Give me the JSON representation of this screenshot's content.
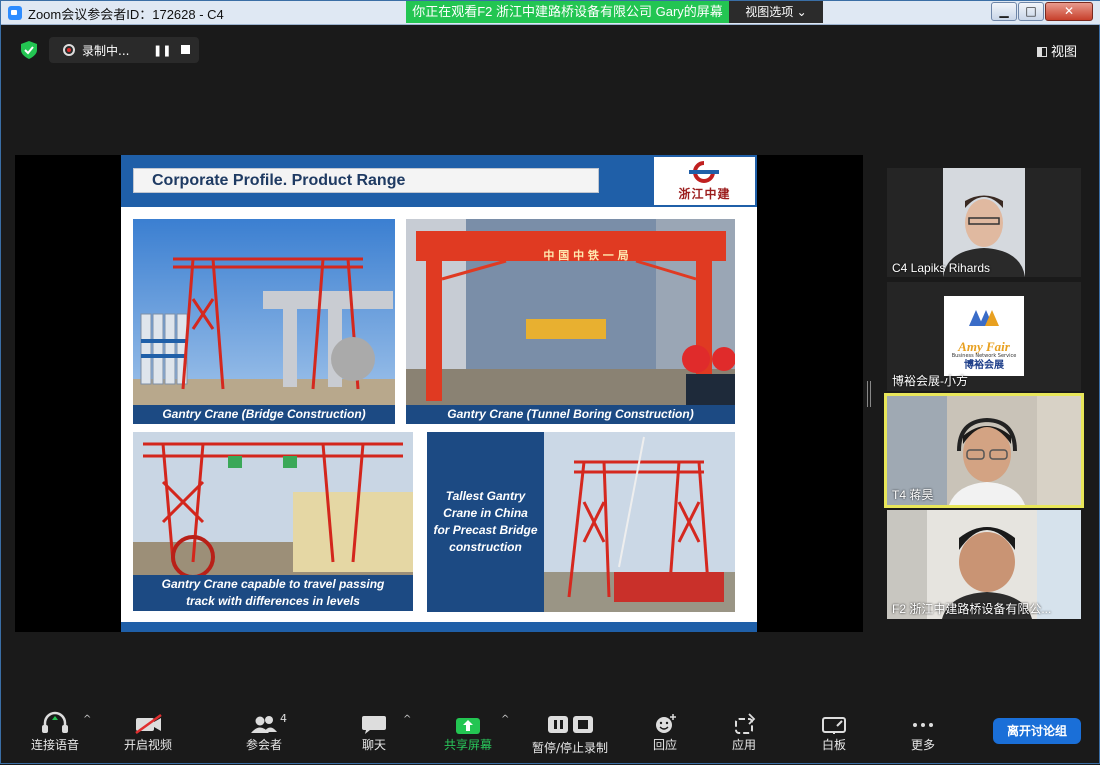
{
  "window": {
    "title": "Zoom会议参会者ID：172628 - C4",
    "minimize": "▁",
    "maximize": "□",
    "close": "✕"
  },
  "banner": {
    "share_text": "你正在观看F2 浙江中建路桥设备有限公司 Gary的屏幕",
    "view_options": "视图选项 ⌄"
  },
  "topbar": {
    "recording_label": "录制中...",
    "pause_symbol": "❚❚",
    "view_label": "视图"
  },
  "slide": {
    "title": "Corporate Profile.    Product Range",
    "logo_text": "浙江中建",
    "photos": [
      {
        "caption": "Gantry Crane (Bridge Construction)"
      },
      {
        "caption": "Gantry Crane (Tunnel Boring Construction)",
        "sign": "中  国  中  铁  一  局"
      },
      {
        "caption_lines": [
          "Gantry Crane capable to travel passing",
          "track with differences in levels"
        ]
      },
      {
        "caption_lines": [
          "Tallest Gantry",
          "Crane in China",
          "for Precast Bridge",
          "construction"
        ]
      }
    ],
    "sign_logo": "Amy  Fair",
    "sign_sub": "Business Network Service",
    "sign_cn": "博裕会展"
  },
  "participants": [
    {
      "name": "C4 Lapiks Rihards",
      "active": false
    },
    {
      "name": "博裕会展-小方",
      "active": false
    },
    {
      "name": "T4 蒋昊",
      "active": true
    },
    {
      "name": "F2 浙江中建路桥设备有限公..."
    }
  ],
  "toolbar": {
    "audio": "连接语音",
    "video": "开启视频",
    "participants": "参会者",
    "participants_count": "4",
    "chat": "聊天",
    "share": "共享屏幕",
    "record": "暂停/停止录制",
    "reactions": "回应",
    "apps": "应用",
    "whiteboard": "白板",
    "more": "更多",
    "leave": "离开讨论组",
    "caret": "^"
  },
  "colors": {
    "share_green": "#23c552",
    "leave_blue": "#1a6fd8",
    "active_speaker": "#e8e65a",
    "slide_blue": "#1f5fa8"
  }
}
